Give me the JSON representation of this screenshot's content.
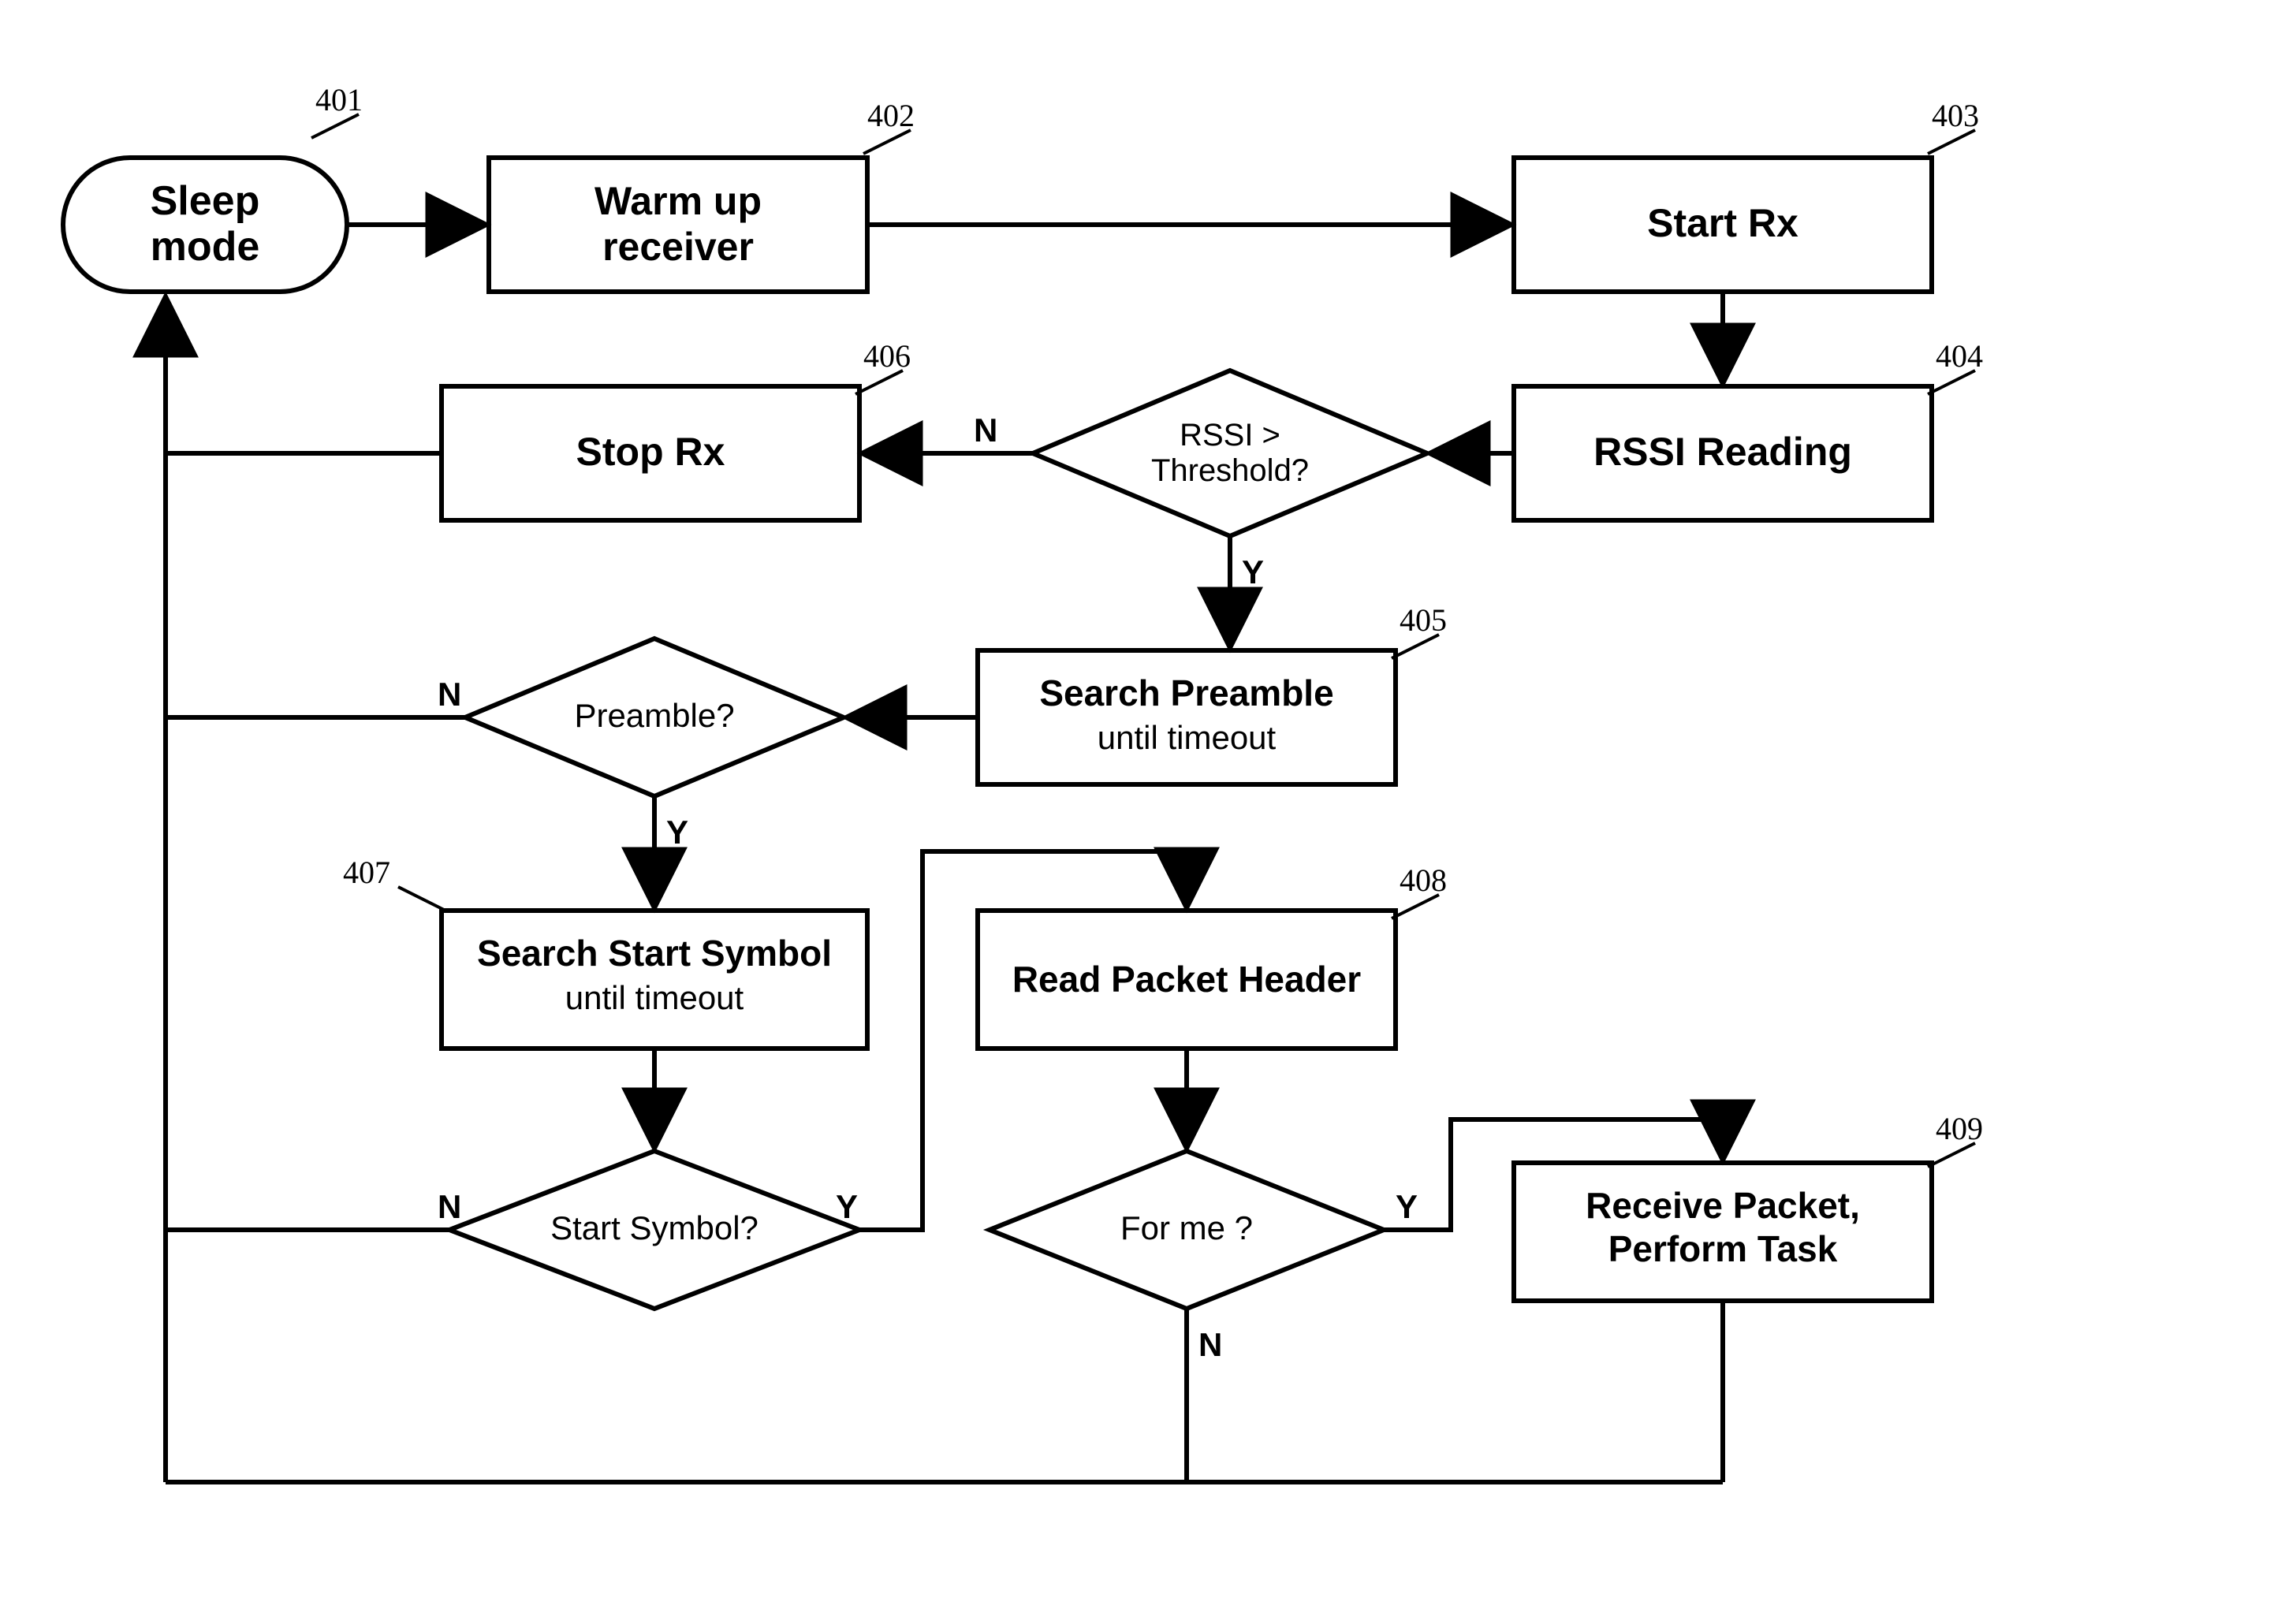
{
  "nodes": {
    "n401": {
      "ref": "401",
      "l1": "Sleep",
      "l2": "mode"
    },
    "n402": {
      "ref": "402",
      "l1": "Warm up",
      "l2": "receiver"
    },
    "n403": {
      "ref": "403",
      "l1": "Start Rx"
    },
    "n404": {
      "ref": "404",
      "l1": "RSSI Reading"
    },
    "n405": {
      "ref": "405",
      "l1": "Search Preamble",
      "l2": "until timeout"
    },
    "n406": {
      "ref": "406",
      "l1": "Stop Rx"
    },
    "n407": {
      "ref": "407",
      "l1": "Search Start Symbol",
      "l2": "until timeout"
    },
    "n408": {
      "ref": "408",
      "l1": "Read Packet Header"
    },
    "n409": {
      "ref": "409",
      "l1": "Receive Packet,",
      "l2": "Perform Task"
    }
  },
  "decisions": {
    "d_rssi": {
      "l1": "RSSI >",
      "l2": "Threshold?"
    },
    "d_pre": {
      "l1": "Preamble?"
    },
    "d_start": {
      "l1": "Start Symbol?"
    },
    "d_forme": {
      "l1": "For me ?"
    }
  },
  "labels": {
    "Y": "Y",
    "N": "N"
  }
}
